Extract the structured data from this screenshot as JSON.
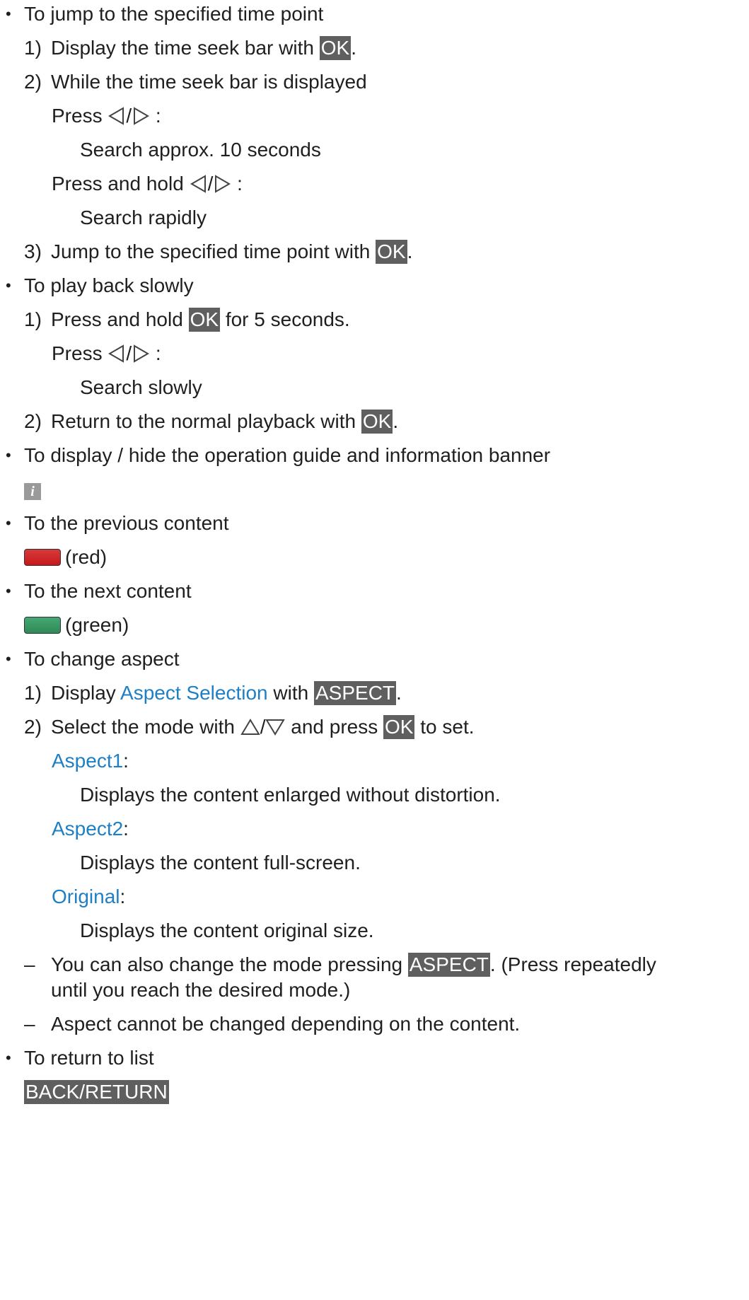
{
  "bullet": "•",
  "dash": "–",
  "sections": {
    "jump": {
      "title": "To jump to the specified time point",
      "step1": {
        "num": "1)",
        "text": "Display the time seek bar with ",
        "key": "OK",
        "end": "."
      },
      "step2": {
        "num": "2)",
        "text": "While the time seek bar is displayed"
      },
      "press": {
        "label": "Press",
        "sep": "/",
        "colon": ":"
      },
      "press_desc": "Search approx. 10 seconds",
      "press_hold": {
        "label": "Press and hold",
        "sep": "/",
        "colon": ":"
      },
      "press_hold_desc": "Search rapidly",
      "step3": {
        "num": "3)",
        "text": "Jump to the specified time point with ",
        "key": "OK",
        "end": "."
      }
    },
    "slow": {
      "title": "To play back slowly",
      "step1": {
        "num": "1)",
        "pre": "Press and hold ",
        "key": "OK",
        "post": " for 5 seconds."
      },
      "press": {
        "label": "Press",
        "sep": "/",
        "colon": ":"
      },
      "press_desc": "Search slowly",
      "step2": {
        "num": "2)",
        "text": "Return to the normal playback with ",
        "key": "OK",
        "end": "."
      }
    },
    "display": {
      "title": "To display / hide the operation guide and information banner",
      "icon": "info-icon"
    },
    "previous": {
      "title": "To the previous content",
      "color_label": "(red)",
      "color": "#c8181c"
    },
    "next": {
      "title": "To the next content",
      "color_label": "(green)",
      "color": "#2f8a57"
    },
    "aspect": {
      "title": "To change aspect",
      "step1": {
        "num": "1)",
        "pre": "Display ",
        "link": "Aspect Selection",
        "mid": " with ",
        "key": "ASPECT",
        "end": "."
      },
      "step2": {
        "num": "2)",
        "pre": "Select the mode with ",
        "sep": "/",
        "mid": " and press ",
        "key": "OK",
        "post": " to set."
      },
      "modes": [
        {
          "name": "Aspect1",
          "desc": "Displays the content enlarged without distortion."
        },
        {
          "name": "Aspect2",
          "desc": "Displays the content full-screen."
        },
        {
          "name": "Original",
          "desc": "Displays the content original size."
        }
      ],
      "colon": ":",
      "note1": {
        "pre": "You can also change the mode pressing ",
        "key": "ASPECT",
        "post": ". (Press repeatedly",
        "cont": "until you reach the desired mode.)"
      },
      "note2": "Aspect cannot be changed depending on the content."
    },
    "return": {
      "title": "To return to list",
      "key": "BACK/RETURN"
    }
  },
  "colors": {
    "key_bg": "#5f5f5f",
    "link": "#1f7fc4"
  }
}
